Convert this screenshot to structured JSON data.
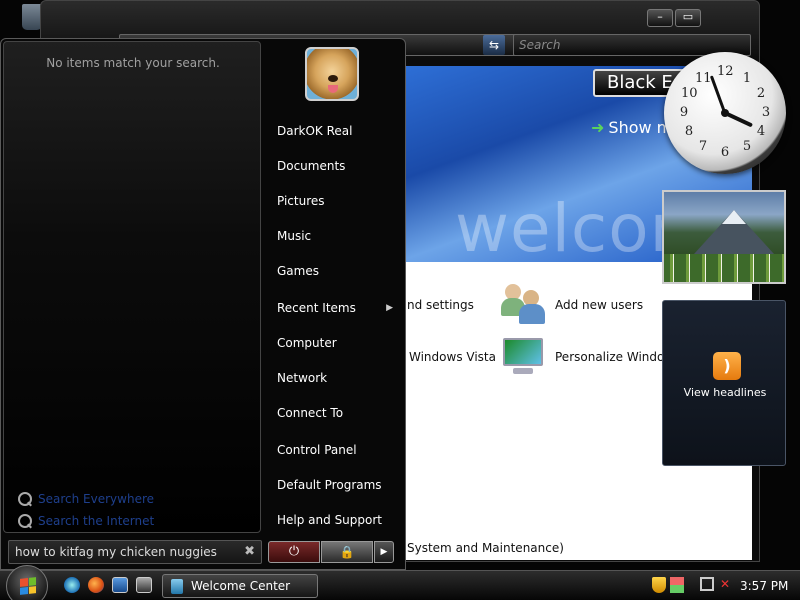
{
  "window": {
    "minimize_label": "–",
    "maximize_label": "▭",
    "close_label": "+",
    "search_placeholder": "Search",
    "address_dropdown": "▼",
    "address_go": "⇆"
  },
  "welcome": {
    "banner_button": "Black E",
    "show_more": "Show m",
    "watermark": "welcom",
    "tasks": [
      {
        "label": "nd settings"
      },
      {
        "label": "Add new users"
      },
      {
        "label": "Windows Vista"
      },
      {
        "label": "Personalize Windows"
      },
      {
        "label": "System and Maintenance)"
      }
    ]
  },
  "gadgets": {
    "clock": {
      "numbers": [
        "12",
        "1",
        "2",
        "3",
        "4",
        "5",
        "6",
        "7",
        "8",
        "9",
        "10",
        "11"
      ]
    },
    "feed": {
      "label": "View headlines",
      "icon": "rss-icon"
    }
  },
  "start_menu": {
    "empty_message": "No items match your search.",
    "search_links": [
      "Search Everywhere",
      "Search the Internet"
    ],
    "search_query": "how to kitfag my chicken nuggies",
    "clear_glyph": "✖",
    "user": "DarkOK Real",
    "items": [
      {
        "label": "Documents"
      },
      {
        "label": "Pictures"
      },
      {
        "label": "Music"
      },
      {
        "label": "Games"
      },
      {
        "label": "Recent Items",
        "submenu": "▶"
      },
      {
        "label": "Computer"
      },
      {
        "label": "Network"
      },
      {
        "label": "Connect To"
      },
      {
        "label": "Control Panel"
      },
      {
        "label": "Default Programs"
      },
      {
        "label": "Help and Support"
      }
    ],
    "power_glyph": "⏻",
    "lock_glyph": "🔒",
    "more_glyph": "▶"
  },
  "taskbar": {
    "active_task": "Welcome Center",
    "clock": "3:57 PM",
    "volume_glyph": "✕"
  },
  "colors": {
    "flag_red": "#e8512f",
    "flag_green": "#6fbd2b",
    "flag_blue": "#2a8be0",
    "flag_yellow": "#f6c22a"
  }
}
